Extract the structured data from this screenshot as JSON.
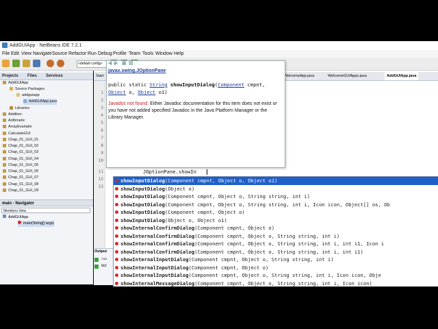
{
  "window": {
    "title": "AddGUIApp - NetBeans IDE 7.2.1"
  },
  "menu": [
    "File",
    "Edit",
    "View",
    "Navigate",
    "Source",
    "Refactor",
    "Run",
    "Debug",
    "Profile",
    "Team",
    "Tools",
    "Window",
    "Help"
  ],
  "toolbar": {
    "config": "<default config>"
  },
  "panels": {
    "projects": "Projects",
    "files": "Files",
    "services": "Services"
  },
  "tree": [
    {
      "label": "AddGUIApp",
      "indent": 0,
      "icon": "project-icon"
    },
    {
      "label": "Source Packages",
      "indent": 1,
      "icon": "package-folder-icon"
    },
    {
      "label": "addguiapp",
      "indent": 2,
      "icon": "package-icon"
    },
    {
      "label": "AddGUIApp.java",
      "indent": 3,
      "icon": "java-file-icon",
      "selected": true
    },
    {
      "label": "Libraries",
      "indent": 1,
      "icon": "library-icon"
    },
    {
      "label": "Addition",
      "indent": 0,
      "icon": "project-icon"
    },
    {
      "label": "Arithmetic",
      "indent": 0,
      "icon": "project-icon"
    },
    {
      "label": "ArrayExample",
      "indent": 0,
      "icon": "project-icon"
    },
    {
      "label": "CalculateGUI",
      "indent": 0,
      "icon": "project-icon"
    },
    {
      "label": "Chap_01_GUI_01",
      "indent": 0,
      "icon": "project-icon"
    },
    {
      "label": "Chap_01_GUI_02",
      "indent": 0,
      "icon": "project-icon"
    },
    {
      "label": "Chap_01_GUI_03",
      "indent": 0,
      "icon": "project-icon"
    },
    {
      "label": "Chap_01_GUI_04",
      "indent": 0,
      "icon": "project-icon"
    },
    {
      "label": "Chap_01_GUI_05",
      "indent": 0,
      "icon": "project-icon"
    },
    {
      "label": "Chap_01_GUI_06",
      "indent": 0,
      "icon": "project-icon"
    },
    {
      "label": "Chap_01_GUI_07",
      "indent": 0,
      "icon": "project-icon"
    },
    {
      "label": "Chap_01_GUI_08",
      "indent": 0,
      "icon": "project-icon"
    },
    {
      "label": "Chap_01_GUI_09",
      "indent": 0,
      "icon": "project-icon"
    }
  ],
  "navigator": {
    "title": "main - Navigator",
    "view": "Members View",
    "items": [
      "AddGUIApp",
      "main(String[] args)"
    ]
  },
  "editor_tabs": [
    "Start",
    "WelcomeApp.java",
    "WelcomeGUIApps.java",
    "AddGUIApp.java"
  ],
  "gutter": [
    "1",
    "2",
    "3",
    "4",
    "5",
    "6",
    "7",
    "8",
    "9",
    "10",
    "11",
    "12",
    "13"
  ],
  "javadoc": {
    "class": "javax.swing.JOptionPane",
    "sig_public": "public static ",
    "sig_return": "String",
    "sig_method": "showInputDialog",
    "sig_open": "(",
    "sig_p1": "Component",
    "sig_p1name": "cmpnt, ",
    "sig_p2": "Object",
    "sig_p2name": " o, ",
    "sig_p3": "Object",
    "sig_p3name": " o1)",
    "not_found": "Javadoc not found.",
    "message": " Either Javadoc documentation for this item does not exist or you have not added specified Javadoc in the Java Platform Manager or the Library Manager."
  },
  "code_line": "JOptionPane.showIn",
  "completions": [
    {
      "name": "showInputDialog",
      "params": "(Component cmpnt, Object o, Object o1)",
      "selected": true
    },
    {
      "name": "showInputDialog",
      "params": "(Object o)"
    },
    {
      "name": "showInputDialog",
      "params": "(Component cmpnt, Object o, String string, int i)"
    },
    {
      "name": "showInputDialog",
      "params": "(Component cmpnt, Object o, String string, int i, Icon icon, Object[] os, Ob"
    },
    {
      "name": "showInputDialog",
      "params": "(Component cmpnt, Object o)"
    },
    {
      "name": "showInputDialog",
      "params": "(Object o, Object o1)"
    },
    {
      "name": "showInternalConfirmDialog",
      "params": "(Component cmpnt, Object o)"
    },
    {
      "name": "showInternalConfirmDialog",
      "params": "(Component cmpnt, Object o, String string, int i)"
    },
    {
      "name": "showInternalConfirmDialog",
      "params": "(Component cmpnt, Object o, String string, int i, int i1, Icon i"
    },
    {
      "name": "showInternalConfirmDialog",
      "params": "(Component cmpnt, Object o, String string, int i, int i1)"
    },
    {
      "name": "showInternalInputDialog",
      "params": "(Component cmpnt, Object o, String string, int i)"
    },
    {
      "name": "showInternalInputDialog",
      "params": "(Component cmpnt, Object o)"
    },
    {
      "name": "showInternalInputDialog",
      "params": "(Component cmpnt, Object o, String string, int i, Icon icon, Obje"
    },
    {
      "name": "showInternalMessageDialog",
      "params": "(Component cmpnt, Object o, String string, int i, Icon icon)"
    }
  ],
  "output": {
    "label": "Output",
    "run1": "run",
    "run2": "BUI"
  }
}
